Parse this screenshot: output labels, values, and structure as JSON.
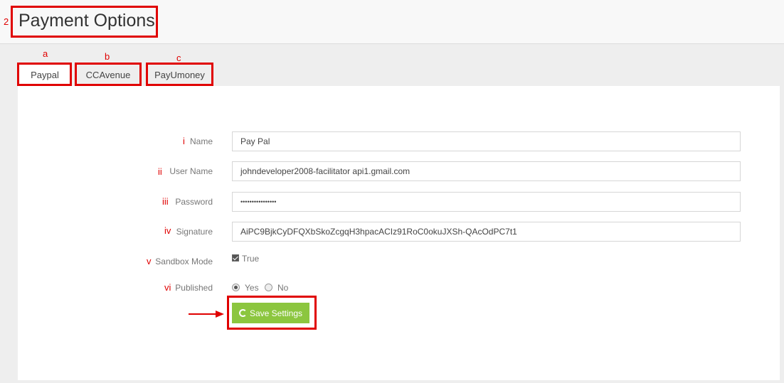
{
  "page": {
    "title": "Payment Options",
    "annotation_number": "2"
  },
  "tabs": [
    {
      "label": "Paypal",
      "annotation": "a"
    },
    {
      "label": "CCAvenue",
      "annotation": "b"
    },
    {
      "label": "PayUmoney",
      "annotation": "c"
    }
  ],
  "form": {
    "name": {
      "label": "Name",
      "annotation": "i",
      "value": "Pay Pal"
    },
    "username": {
      "label": "User Name",
      "annotation": "ii",
      "value": "johndeveloper2008-facilitator  api1.gmail.com"
    },
    "password": {
      "label": "Password",
      "annotation": "iii",
      "value": "••••••••••••••••"
    },
    "signature": {
      "label": "Signature",
      "annotation": "iv",
      "value": "AiPC9BjkCyDFQXbSkoZcgqH3hpacACIz91RoC0okuJXSh-QAcOdPC7t1"
    },
    "sandbox": {
      "label": "Sandbox Mode",
      "annotation": "v",
      "checkbox_label": "True",
      "checked": true
    },
    "published": {
      "label": "Published",
      "annotation": "vi",
      "options": [
        "Yes",
        "No"
      ],
      "selected": "Yes"
    }
  },
  "save_button": {
    "label": "Save Settings",
    "color": "#8cc63f"
  },
  "annotation_color": "#e00000"
}
